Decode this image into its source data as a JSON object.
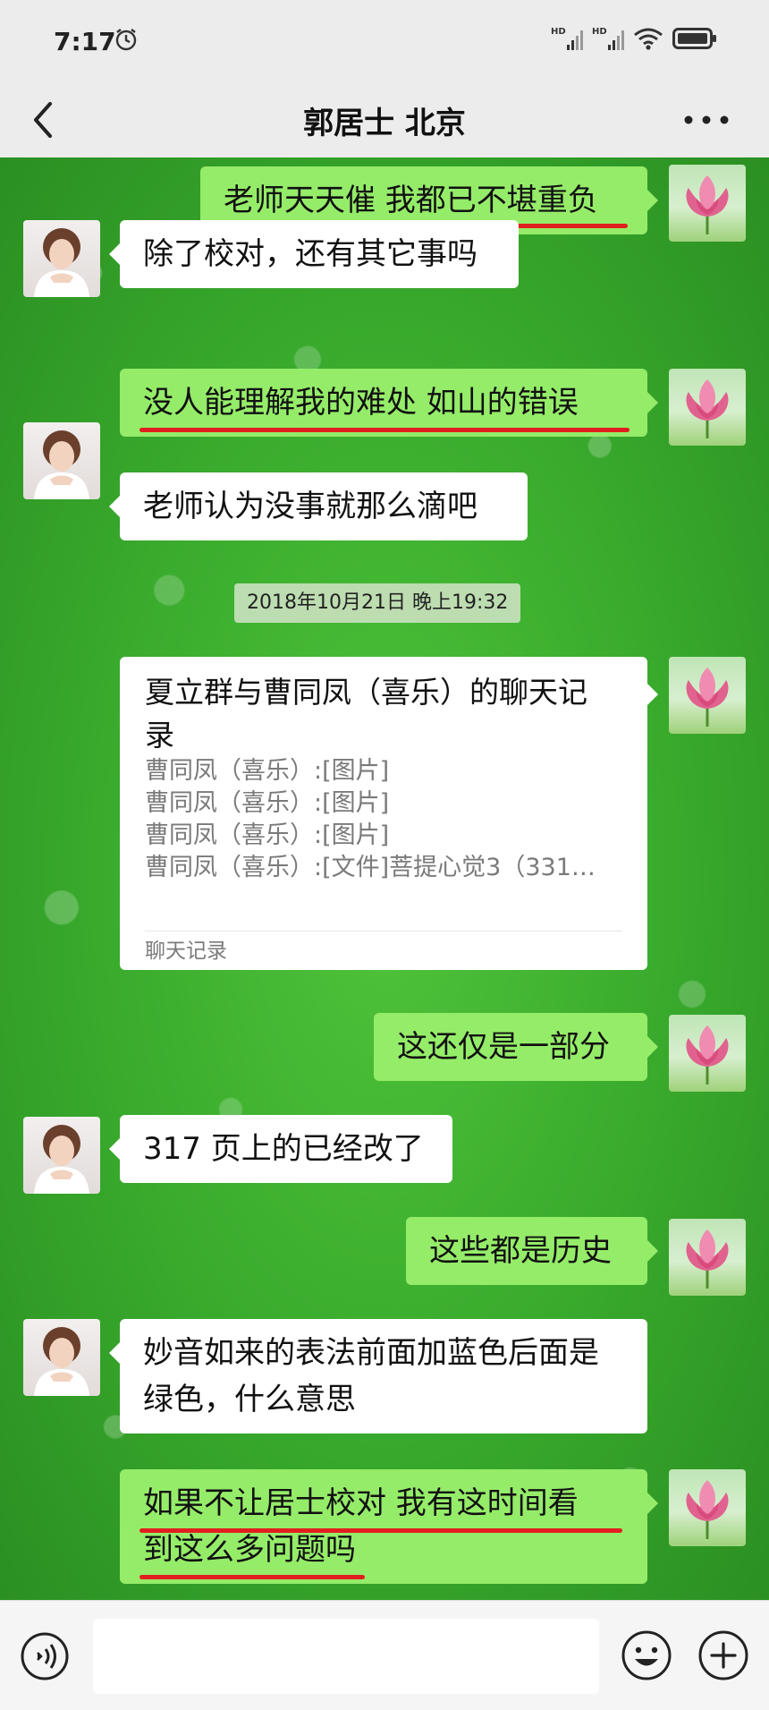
{
  "status_bar": {
    "time": "7:17",
    "icons": [
      "alarm-icon",
      "hd-signal-icon",
      "hd-signal-icon",
      "wifi-icon",
      "battery-icon"
    ]
  },
  "header": {
    "title": "郭居士 北京",
    "back_icon": "chevron-left-icon",
    "more_icon": "more-dots-icon"
  },
  "messages": [
    {
      "side": "right",
      "text": "老师天天催 我都已不堪重负",
      "underlined": true
    },
    {
      "side": "left",
      "text": "除了校对，还有其它事吗"
    },
    {
      "side": "right",
      "text": "没人能理解我的难处 如山的错误",
      "underlined": true
    },
    {
      "side": "left",
      "text": "老师认为没事就那么滴吧"
    },
    {
      "side": "right",
      "text": "这还仅是一部分"
    },
    {
      "side": "left",
      "text": "317 页上的已经改了"
    },
    {
      "side": "right",
      "text": "这些都是历史"
    },
    {
      "side": "left",
      "lines": [
        "妙音如来的表法前面加蓝色后面是",
        "绿色，什么意思"
      ]
    },
    {
      "side": "right",
      "lines": [
        "如果不让居士校对 我有这时间看",
        "到这么多问题吗"
      ],
      "underlined": true
    }
  ],
  "timestamp": "2018年10月21日 晚上19:32",
  "chat_record_card": {
    "title_lines": [
      "夏立群与曹同凤（喜乐）的聊天记",
      "录"
    ],
    "lines": [
      "曹同凤（喜乐）:[图片]",
      "曹同凤（喜乐）:[图片]",
      "曹同凤（喜乐）:[图片]",
      "曹同凤（喜乐）:[文件]菩提心觉3（331…"
    ],
    "footer": "聊天记录"
  },
  "colors": {
    "sent_bubble": "#95ec69",
    "received_bubble": "#ffffff",
    "underline": "#e21f1f",
    "background_green": "#38a92c"
  },
  "input": {
    "voice_icon": "voice-icon",
    "emoji_icon": "emoji-icon",
    "plus_icon": "plus-circle-icon"
  }
}
